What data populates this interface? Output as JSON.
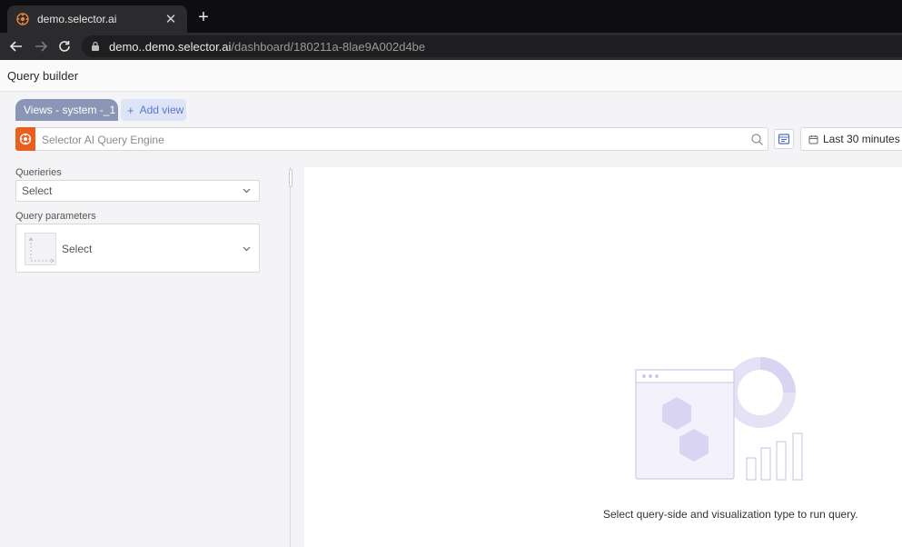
{
  "browser": {
    "tab_title": "demo.selector.ai",
    "tab_close": "✕",
    "new_tab": "+",
    "url_host": "demo..demo.selector.ai",
    "url_path": "/dashboard/180211a-8lae9A002d4be"
  },
  "header": {
    "title": "Query builder"
  },
  "views": {
    "active_tab": "Views - system -_1",
    "add_view_icon": "+",
    "add_view_label": "Add view"
  },
  "query_bar": {
    "placeholder": "Selector AI Query Engine",
    "time_range": "Last 30 minutes"
  },
  "left_panel": {
    "queries_label": "Querieries",
    "queries_value": "Select",
    "params_label": "Query parameters",
    "params_value": "Select"
  },
  "main": {
    "empty_hint": "Select query-side and visualization type to run query."
  },
  "colors": {
    "brand_orange": "#e85f20",
    "view_tab": "#8b96b6",
    "add_view_bg": "#dde4f7",
    "add_view_text": "#5a78c9",
    "illustration": "#d9d4f2"
  },
  "icons": [
    "selector-logo-icon",
    "close-icon",
    "plus-icon",
    "back-arrow-icon",
    "forward-arrow-icon",
    "reload-icon",
    "lock-icon",
    "search-icon",
    "api-icon",
    "calendar-icon",
    "chevron-down-icon",
    "chart-placeholder-icon"
  ]
}
